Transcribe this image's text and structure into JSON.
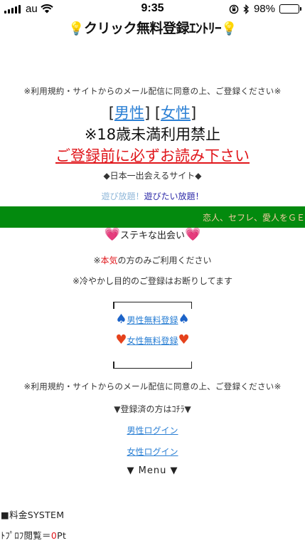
{
  "status_bar": {
    "carrier": "au",
    "time": "9:35",
    "battery": "98%",
    "battery_level": 0.98
  },
  "header": {
    "title": "クリック無料登録ｴﾝﾄﾘｰ"
  },
  "content": {
    "notice_top": "※利用規約・サイトからのメール配信に同意の上、ご登録ください※",
    "bracket_open": "[",
    "bracket_close": "]",
    "male_link": "男性",
    "female_link": "女性",
    "age_limit": "※18歳未満利用禁止",
    "read_first": "ご登録前に必ずお読み下さい",
    "best_site": "◆日本一出会えるサイト◆",
    "play_all_light": "遊び放題！",
    "play_all_dark": "遊びたい放題！",
    "marquee": "恋人、セフレ、愛人をＧＥＴ",
    "nice_meeting": "ステキな出会い",
    "serious_pre": "※",
    "serious_word": "本気",
    "serious_post": "の方のみご利用ください",
    "no_joke": "※冷やかし目的のご登録はお断りしてます",
    "male_register": "男性無料登録",
    "female_register": "女性無料登録",
    "notice_bottom": "※利用規約・サイトからのメール配信に同意の上、ご登録ください※",
    "registered": "▼登録済の方はｺﾁﾗ▼",
    "male_login": "男性ログイン",
    "female_login": "女性ログイン",
    "menu": "▼ Menu ▼",
    "fee_system": "■料金SYSTEM",
    "profile_view_label": "ﾄﾌﾟﾛﾌ閲覧＝",
    "profile_view_value": "0",
    "profile_view_unit": "Pt"
  }
}
